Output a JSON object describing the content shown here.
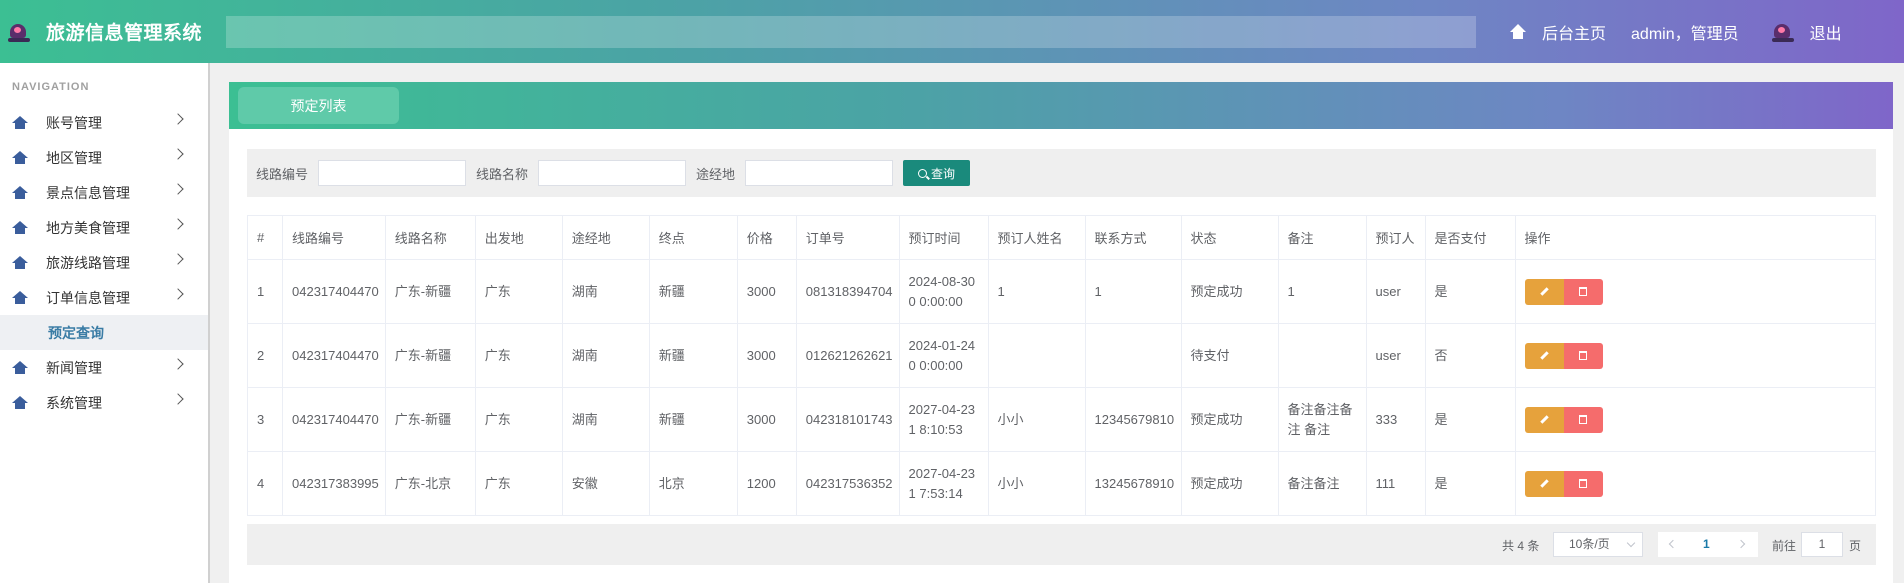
{
  "app": {
    "title": "旅游信息管理系统"
  },
  "topnav": {
    "home_label": "后台主页",
    "user_label": "admin，管理员",
    "logout_label": "退出"
  },
  "sidebar": {
    "header": "NAVIGATION",
    "items": [
      {
        "label": "账号管理"
      },
      {
        "label": "地区管理"
      },
      {
        "label": "景点信息管理"
      },
      {
        "label": "地方美食管理"
      },
      {
        "label": "旅游线路管理"
      },
      {
        "label": "订单信息管理"
      },
      {
        "label": "新闻管理"
      },
      {
        "label": "系统管理"
      }
    ],
    "active_sub": "预定查询"
  },
  "panel": {
    "tab": "预定列表"
  },
  "search": {
    "route_no_label": "线路编号",
    "route_name_label": "线路名称",
    "via_label": "途经地",
    "button": "查询"
  },
  "table": {
    "headers": [
      "#",
      "线路编号",
      "线路名称",
      "出发地",
      "途经地",
      "终点",
      "价格",
      "订单号",
      "预订时间",
      "预订人姓名",
      "联系方式",
      "状态",
      "备注",
      "预订人",
      "是否支付",
      "操作"
    ],
    "rows": [
      [
        "1",
        "042317404470",
        "广东-新疆",
        "广东",
        "湖南",
        "新疆",
        "3000",
        "081318394704",
        "2024-08-30 0 0:00:00",
        "1",
        "1",
        "预定成功",
        "1",
        "user",
        "是"
      ],
      [
        "2",
        "042317404470",
        "广东-新疆",
        "广东",
        "湖南",
        "新疆",
        "3000",
        "012621262621",
        "2024-01-24 0 0:00:00",
        "",
        "",
        "待支付",
        "",
        "user",
        "否"
      ],
      [
        "3",
        "042317404470",
        "广东-新疆",
        "广东",
        "湖南",
        "新疆",
        "3000",
        "042318101743",
        "2027-04-23 1 8:10:53",
        "小小",
        "12345679810",
        "预定成功",
        "备注备注备注 备注",
        "333",
        "是"
      ],
      [
        "4",
        "042317383995",
        "广东-北京",
        "广东",
        "安徽",
        "北京",
        "1200",
        "042317536352",
        "2027-04-23 1 7:53:14",
        "小小",
        "13245678910",
        "预定成功",
        "备注备注",
        "111",
        "是"
      ]
    ]
  },
  "pager": {
    "total": "共 4 条",
    "page_size": "10条/页",
    "current": "1",
    "goto_label": "前往",
    "goto_value": "1",
    "page_suffix": "页"
  }
}
